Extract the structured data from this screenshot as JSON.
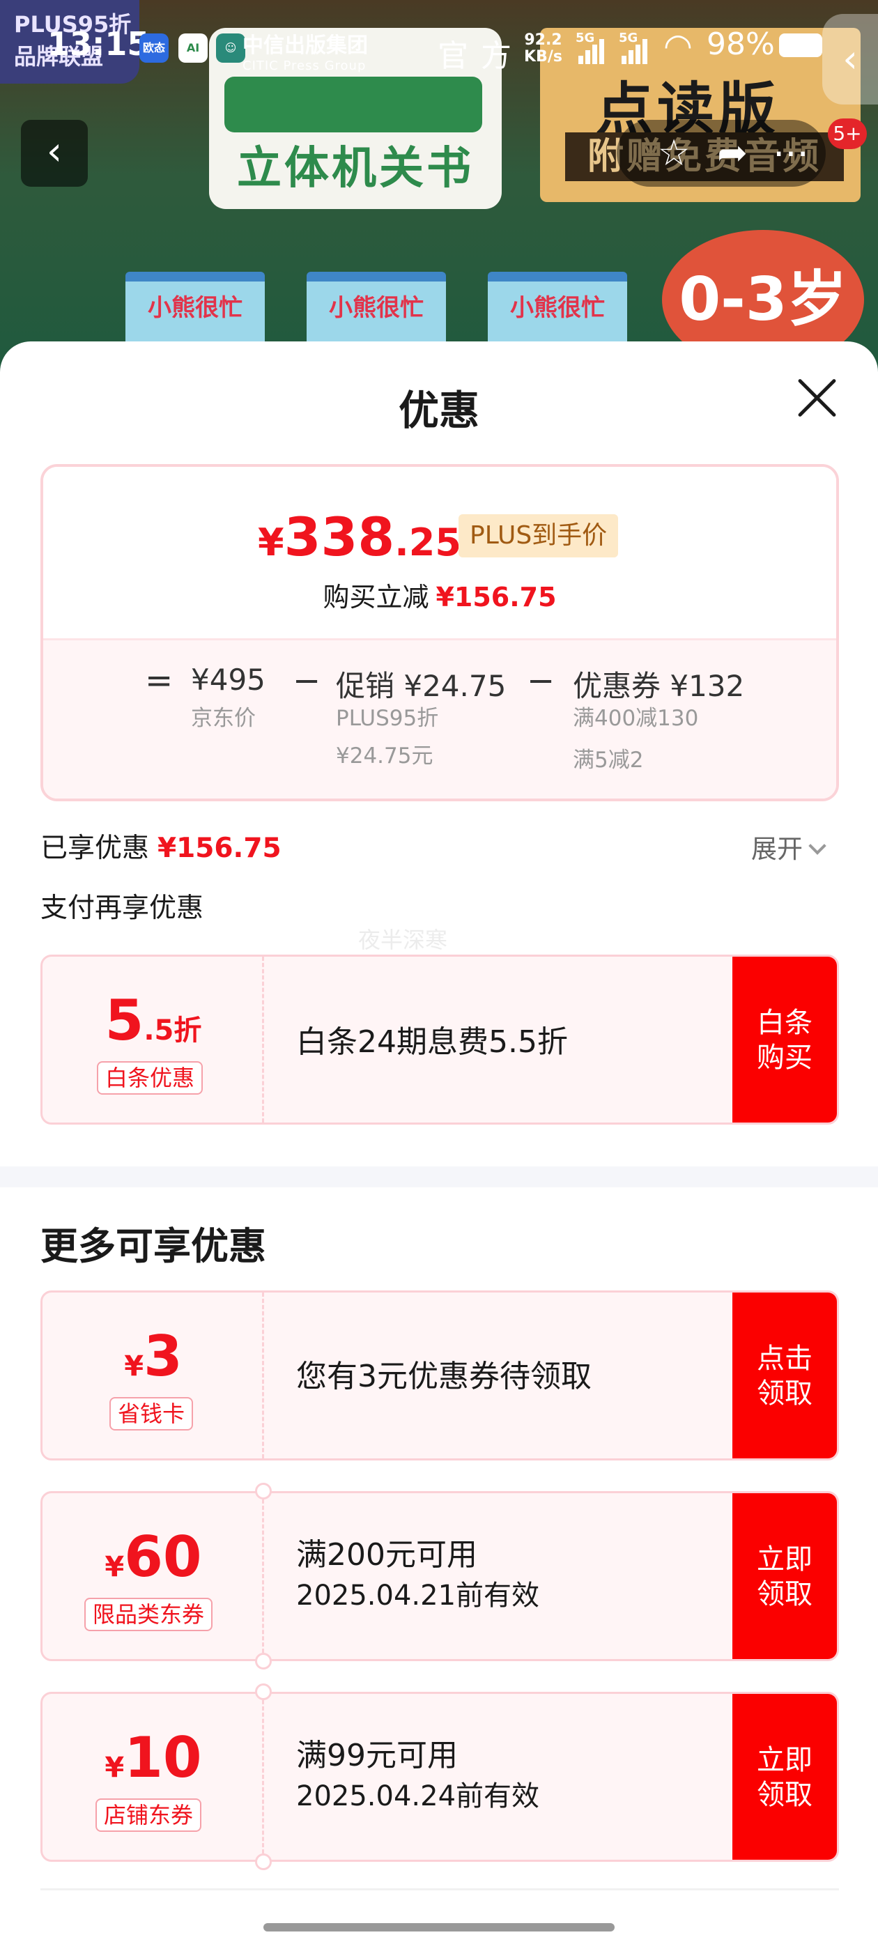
{
  "status_bar": {
    "time": "13:15",
    "apps": [
      "欧态",
      "AI"
    ],
    "citic_title": "中信出版集团",
    "citic_sub": "CITIC Press Group",
    "official": "官方",
    "net_speed": "92.2",
    "net_unit": "KB/s",
    "signal1": "5G",
    "signal2": "5G",
    "battery": "98%"
  },
  "banner": {
    "plus_badge_line1": "PLUS95折",
    "plus_badge_line2": "品牌联盟",
    "sign_title": "立体机关书",
    "orange_top": "点读版",
    "orange_bottom": "附赠免费音频",
    "age": "0-3岁",
    "book_title": "小熊很忙",
    "notif_count": "5+"
  },
  "sheet": {
    "title": "优惠",
    "price": {
      "currency": "¥",
      "integer": "338",
      "decimal": ".25"
    },
    "plus_tag": "PLUS到手价",
    "reduce_label": "购买立减",
    "reduce_amount": "¥156.75",
    "calc": {
      "eq": "=",
      "jd_price": "¥495",
      "jd_label": "京东价",
      "minus1": "−",
      "promo": "促销 ¥24.75",
      "promo_sub1": "PLUS95折",
      "promo_sub2": "¥24.75元",
      "minus2": "−",
      "coupon": "优惠券 ¥132",
      "coupon_sub1": "满400减130",
      "coupon_sub2": "满5减2"
    },
    "enjoyed_label": "已享优惠",
    "enjoyed_amount": "¥156.75",
    "expand_label": "展开",
    "pay_title": "支付再享优惠",
    "watermark": "夜半深寒",
    "baitiao": {
      "value_big": "5",
      "value_small": ".5折",
      "tag": "白条优惠",
      "desc": "白条24期息费5.5折",
      "action_line1": "白条",
      "action_line2": "购买"
    },
    "more_title": "更多可享优惠",
    "coupons": [
      {
        "currency": "¥",
        "amount": "3",
        "tag": "省钱卡",
        "desc1": "您有3元优惠券待领取",
        "desc2": "",
        "action_line1": "点击",
        "action_line2": "领取"
      },
      {
        "currency": "¥",
        "amount": "60",
        "tag": "限品类东券",
        "desc1": "满200元可用",
        "desc2": "2025.04.21前有效",
        "action_line1": "立即",
        "action_line2": "领取"
      },
      {
        "currency": "¥",
        "amount": "10",
        "tag": "店铺东券",
        "desc1": "满99元可用",
        "desc2": "2025.04.24前有效",
        "action_line1": "立即",
        "action_line2": "领取"
      }
    ]
  },
  "colors": {
    "accent_red": "#f0141e",
    "action_red": "#fb0000",
    "coupon_bg": "#fff5f6",
    "plus_tag_bg": "#fde9c8"
  }
}
